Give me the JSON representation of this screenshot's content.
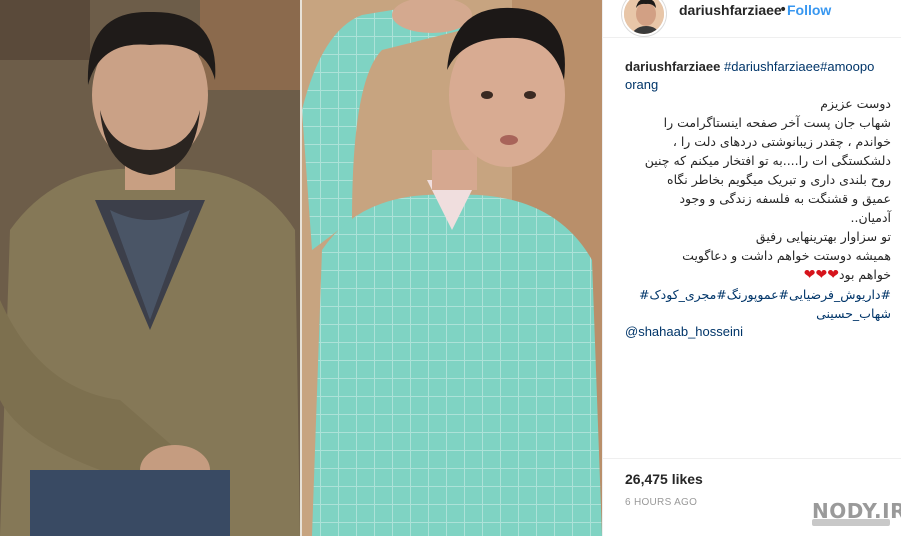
{
  "header": {
    "username": "dariushfarziaee",
    "separator": "•",
    "follow_label": "Follow",
    "accent_color": "#3897f0"
  },
  "caption": {
    "username": "dariushfarziaee",
    "hashtags_inline": "#dariushfarziaee#amoopo orang",
    "lines": [
      "دوست عزیزم",
      "شهاب جان پست آخر صفحه اینستاگرامت را",
      "خواندم ، چقدر زیبانوشتی دردهای دلت را ،",
      "دلشکستگی ات را....به تو افتخار میکنم که چنین",
      "روح بلندی داری و تبریک میگویم بخاطر نگاه",
      "عمیق و قشنگت به فلسفه زندگی و وجود",
      "آدمیان..",
      "تو سزاوار بهترینهایی رفیق",
      "همیشه دوستت خواهم داشت و دعاگویت"
    ],
    "last_line_text": "خواهم بود",
    "hearts": "❤❤❤",
    "hashtag_line_1": "#داریوش_فرضیایی#عموپورنگ#مجری_کودک#",
    "hashtag_line_2": "شهاب_حسینی",
    "mention": "@shahaab_hosseini"
  },
  "footer": {
    "likes": "26,475 likes",
    "timestamp": "6 HOURS AGO"
  },
  "watermark": {
    "text": "NODY.IR"
  }
}
